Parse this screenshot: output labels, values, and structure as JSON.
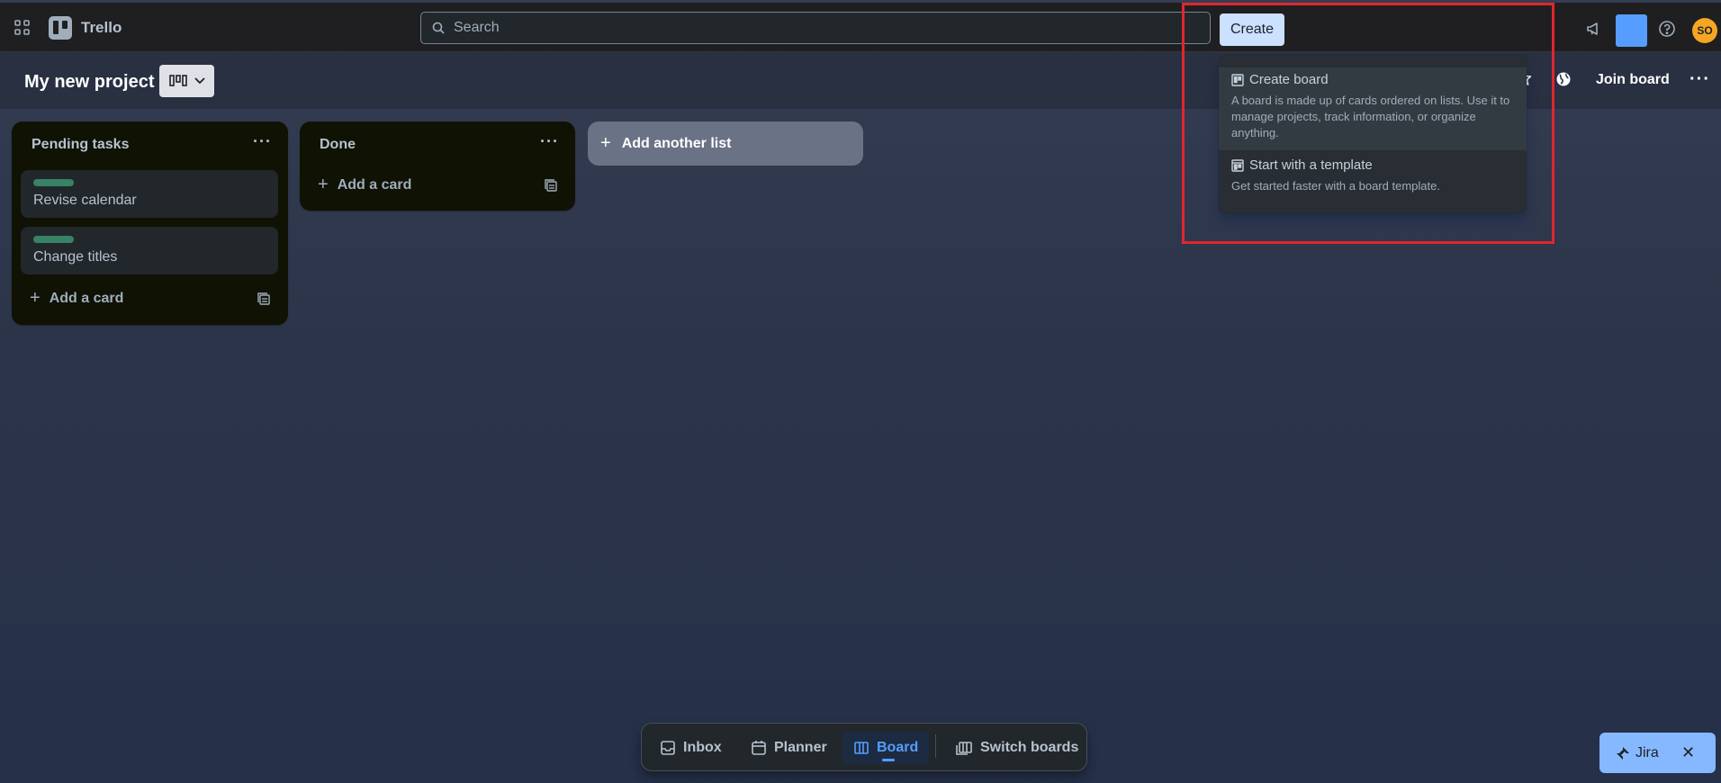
{
  "app": {
    "name": "Trello"
  },
  "header": {
    "search_placeholder": "Search",
    "create_label": "Create",
    "avatar_initials": "SO"
  },
  "board": {
    "title": "My new project",
    "join_label": "Join board"
  },
  "lists": [
    {
      "title": "Pending tasks",
      "cards": [
        {
          "text": "Revise calendar",
          "label_color": "#4bce97"
        },
        {
          "text": "Change titles",
          "label_color": "#4bce97"
        }
      ],
      "add_card_label": "Add a card"
    },
    {
      "title": "Done",
      "cards": [],
      "add_card_label": "Add a card"
    }
  ],
  "add_list_label": "Add another list",
  "create_menu": {
    "items": [
      {
        "title": "Create board",
        "description": "A board is made up of cards ordered on lists. Use it to manage projects, track information, or organize anything."
      },
      {
        "title": "Start with a template",
        "description": "Get started faster with a board template."
      }
    ]
  },
  "bottom_nav": {
    "items": [
      {
        "label": "Inbox"
      },
      {
        "label": "Planner"
      },
      {
        "label": "Board",
        "active": true
      },
      {
        "label": "Switch boards"
      }
    ]
  },
  "jira_banner": {
    "label": "Jira"
  },
  "colors": {
    "accent": "#579dff",
    "create_button": "#cce0ff",
    "highlight_box": "#e0262e",
    "avatar": "#f5a623"
  },
  "icons": [
    "apps-grid-icon",
    "trello-logo-icon",
    "search-icon",
    "megaphone-icon",
    "help-icon",
    "board-view-icon",
    "chevron-down-icon",
    "star-icon",
    "globe-icon",
    "more-icon",
    "plus-icon",
    "card-template-icon",
    "inbox-icon",
    "calendar-icon",
    "board-icon",
    "switch-boards-icon",
    "jira-icon",
    "close-icon"
  ]
}
